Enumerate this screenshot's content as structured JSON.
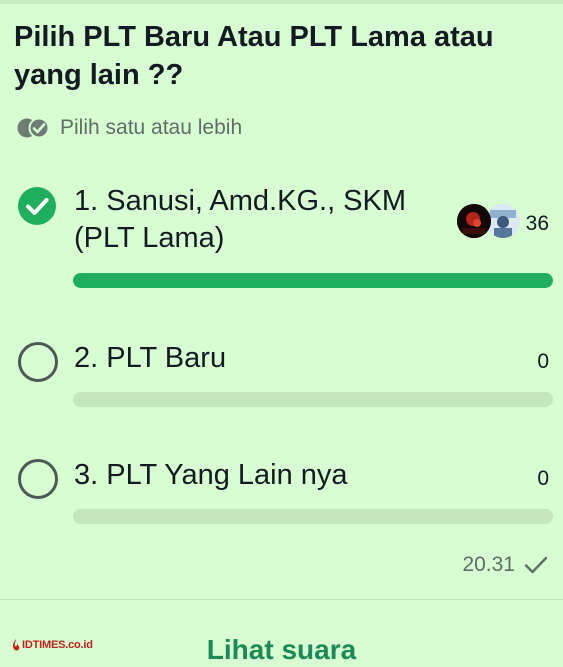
{
  "poll": {
    "title": "Pilih PLT Baru Atau PLT Lama atau yang lain ??",
    "hint": "Pilih satu atau lebih",
    "options": [
      {
        "label_line1": "1. Sanusi, Amd.KG., SKM",
        "label_line2": "(PLT Lama)",
        "count": "36",
        "selected": true,
        "vote_share": 1.0
      },
      {
        "label_line1": "2. PLT Baru",
        "count": "0",
        "selected": false,
        "vote_share": 0
      },
      {
        "label_line1": "3. PLT Yang Lain nya",
        "count": "0",
        "selected": false,
        "vote_share": 0
      }
    ],
    "timestamp": "20.31",
    "view_votes_label": "Lihat suara"
  },
  "watermark": {
    "text": "IDTIMES.co.id"
  },
  "colors": {
    "background": "#d8fdd2",
    "accent": "#1fae5d",
    "bar_track": "#c4e6bd",
    "link": "#1b8a56"
  },
  "icons": {
    "hint": "double-check-circle-icon",
    "selected": "check-circle-icon",
    "unselected": "radio-empty-icon",
    "timestamp": "single-check-icon"
  }
}
